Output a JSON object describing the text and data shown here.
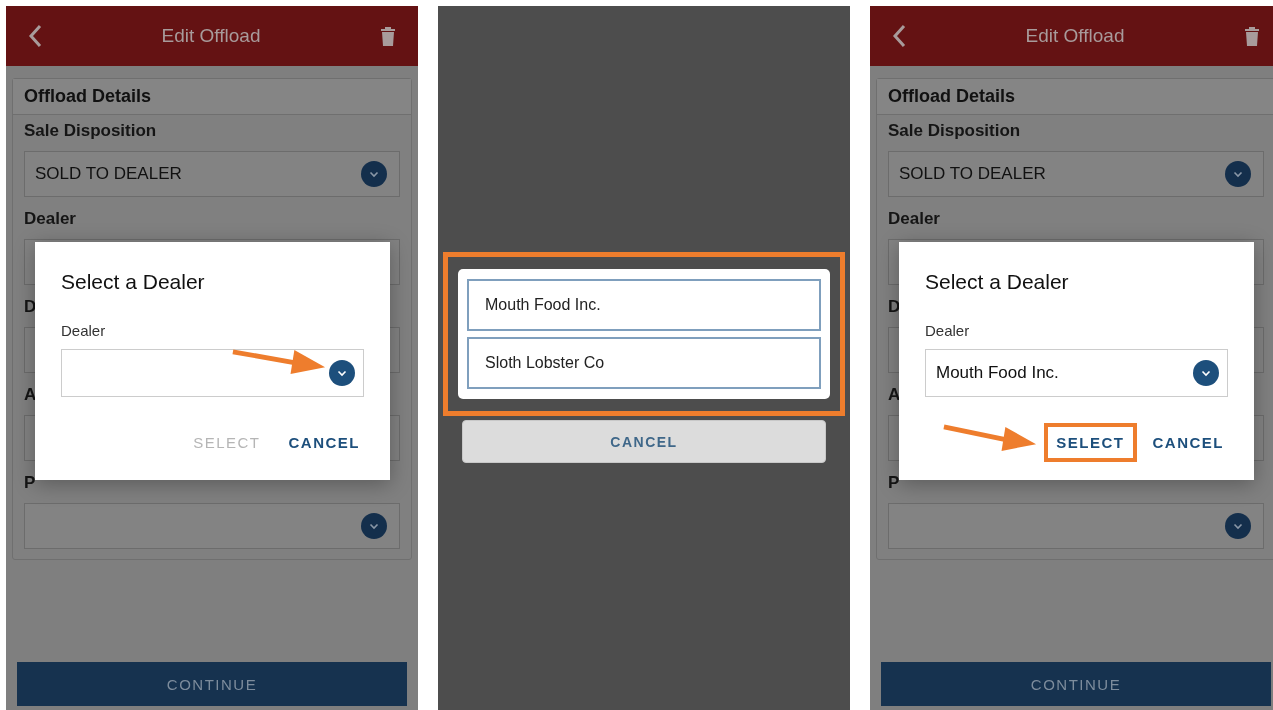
{
  "screens": [
    {
      "kind": "form",
      "header": {
        "title": "Edit Offload"
      },
      "section_title": "Offload Details",
      "fields": [
        {
          "label": "Sale Disposition",
          "value": "SOLD TO DEALER",
          "dropdown": true
        },
        {
          "label": "Dealer"
        },
        {
          "label": "D"
        },
        {
          "label": "A"
        },
        {
          "label": "P",
          "dropdown": true
        }
      ],
      "dialog": {
        "title": "Select a Dealer",
        "field_label": "Dealer",
        "dropdown_pointed": true,
        "buttons": [
          {
            "label": "SELECT",
            "disabled": true,
            "pointed": false
          },
          {
            "label": "CANCEL",
            "disabled": false,
            "pointed": false
          }
        ]
      },
      "continue_button": "CONTINUE"
    },
    {
      "kind": "picker",
      "highlighted": true,
      "options": [
        {
          "label": "Mouth Food Inc."
        },
        {
          "label": "Sloth Lobster Co"
        }
      ],
      "cancel_button": "CANCEL"
    },
    {
      "kind": "form",
      "header": {
        "title": "Edit Offload"
      },
      "section_title": "Offload Details",
      "fields": [
        {
          "label": "Sale Disposition",
          "value": "SOLD TO DEALER",
          "dropdown": true
        },
        {
          "label": "Dealer"
        },
        {
          "label": "D"
        },
        {
          "label": "A"
        },
        {
          "label": "P",
          "dropdown": true
        }
      ],
      "dialog": {
        "title": "Select a Dealer",
        "field_label": "Dealer",
        "value": "Mouth Food Inc.",
        "dropdown_pointed": false,
        "buttons": [
          {
            "label": "SELECT",
            "disabled": false,
            "pointed": true
          },
          {
            "label": "CANCEL",
            "disabled": false,
            "pointed": false
          }
        ]
      },
      "continue_button": "CONTINUE"
    }
  ]
}
